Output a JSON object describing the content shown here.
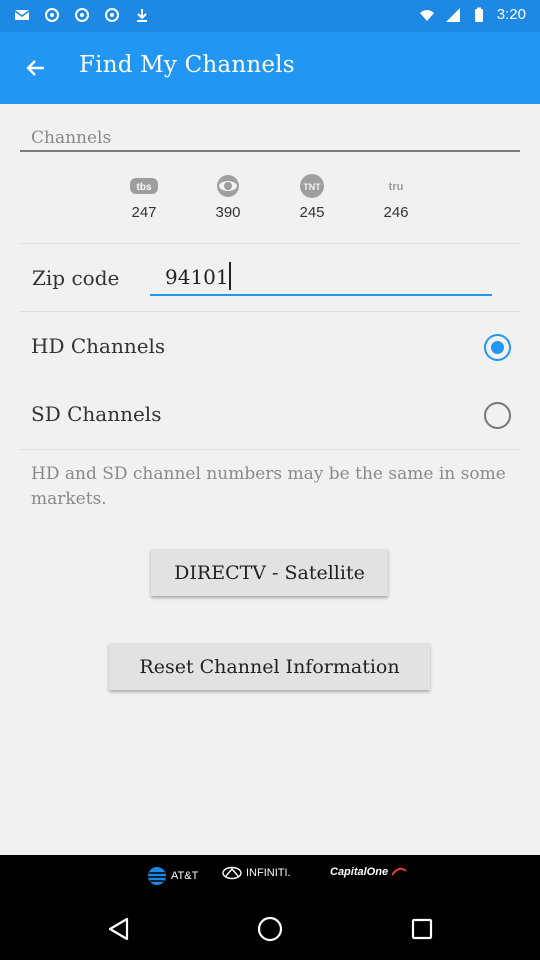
{
  "status_bar": {
    "time": "3:20",
    "icons": [
      "gmail-icon",
      "settings-icon",
      "settings-icon",
      "settings-icon",
      "download-icon",
      "wifi-icon",
      "signal-icon",
      "battery-icon"
    ]
  },
  "app_bar": {
    "title": "Find My Channels",
    "back_icon": "back-arrow-icon"
  },
  "channels_section": {
    "label": "Channels",
    "items": [
      {
        "network": "tbs",
        "number": "247"
      },
      {
        "network": "eye-network",
        "number": "390"
      },
      {
        "network": "TNT",
        "number": "245"
      },
      {
        "network": "tru",
        "number": "246"
      }
    ]
  },
  "zip": {
    "label": "Zip code",
    "value": "94101"
  },
  "options": {
    "hd_label": "HD Channels",
    "hd_selected": true,
    "sd_label": "SD Channels",
    "sd_selected": false
  },
  "note": "HD and SD channel numbers may be the same in some markets.",
  "buttons": {
    "provider": "DIRECTV - Satellite",
    "reset": "Reset Channel Information"
  },
  "sponsors": [
    {
      "name": "AT&T"
    },
    {
      "name": "INFINITI."
    },
    {
      "name": "CapitalOne"
    }
  ],
  "colors": {
    "status_bar": "#1e88e5",
    "app_bar": "#2196f3",
    "accent": "#2196f3",
    "background": "#f1f1f1"
  }
}
